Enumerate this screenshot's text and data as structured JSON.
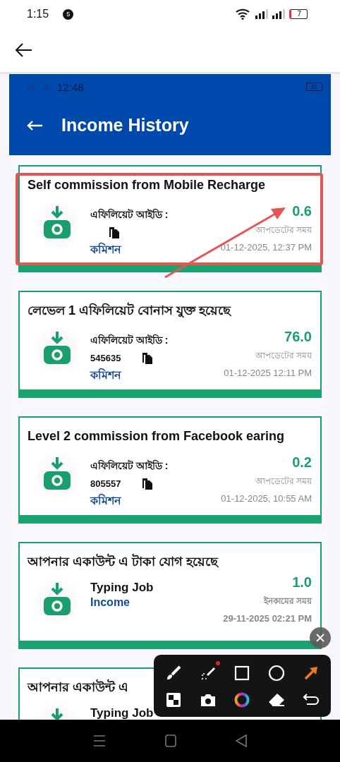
{
  "status_bar": {
    "time": "1:15",
    "notification_count": "5",
    "battery": "7"
  },
  "screenshot": {
    "status_bar": {
      "time": "12:48",
      "battery": "11"
    },
    "title": "Income History",
    "cards": [
      {
        "kind": "affiliate",
        "title": "Self commission from Mobile Recharge",
        "id_label": "এফিলিয়েট আইডি :",
        "type_label": "কমিশন",
        "amount": "0.6",
        "time_label": "আপডেটের সময়",
        "timestamp": "01-12-2025, 12:37 PM"
      },
      {
        "kind": "affiliate",
        "title": "লেভেল 1 এফিলিয়েট বোনাস যুক্ত হয়েছে",
        "id_label": "এফিলিয়েট আইডি :",
        "affiliate_id": "545635",
        "type_label": "কমিশন",
        "amount": "76.0",
        "time_label": "আপডেটের সময়",
        "timestamp": "01-12-2025 12:11 PM"
      },
      {
        "kind": "affiliate",
        "title": "Level 2 commission from Facebook earing",
        "id_label": "এফিলিয়েট আইডি :",
        "affiliate_id": "805557",
        "type_label": "কমিশন",
        "amount": "0.2",
        "time_label": "আপডেটের সময়",
        "timestamp": "01-12-2025, 10:55 AM"
      },
      {
        "kind": "job",
        "title": "আপনার একাউন্ট এ টাকা যোগ হয়েছে",
        "job_name": "Typing Job",
        "type_label": "Income",
        "amount": "1.0",
        "time_label": "ইনকামের সময়",
        "timestamp": "29-11-2025 02:21 PM"
      },
      {
        "kind": "job",
        "title": "আপনার একাউন্ট এ",
        "job_name": "Typing Job"
      }
    ]
  }
}
